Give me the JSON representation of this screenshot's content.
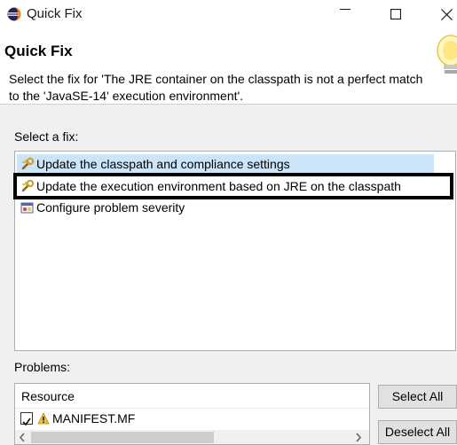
{
  "window": {
    "title": "Quick Fix"
  },
  "header": {
    "title": "Quick Fix",
    "description": "Select the fix for 'The JRE container on the classpath is not a perfect match to the 'JavaSE-14' execution environment'."
  },
  "fixes": {
    "label": "Select a fix:",
    "items": [
      {
        "label": "Update the classpath and compliance settings",
        "icon": "wrench-change-icon",
        "state": "selected"
      },
      {
        "label": "Update the execution environment based on JRE on the classpath",
        "icon": "wrench-change-icon",
        "state": "focused"
      },
      {
        "label": "Configure problem severity",
        "icon": "severity-config-icon",
        "state": "normal"
      }
    ]
  },
  "problems": {
    "label": "Problems:",
    "column_header": "Resource",
    "rows": [
      {
        "checked": true,
        "icon": "warning-icon",
        "label": "MANIFEST.MF"
      }
    ]
  },
  "buttons": {
    "select_all": "Select All",
    "deselect_all": "Deselect All"
  },
  "colors": {
    "selection": "#cce4f7",
    "focus_outline": "#000000",
    "warning": "#f2c12e"
  }
}
